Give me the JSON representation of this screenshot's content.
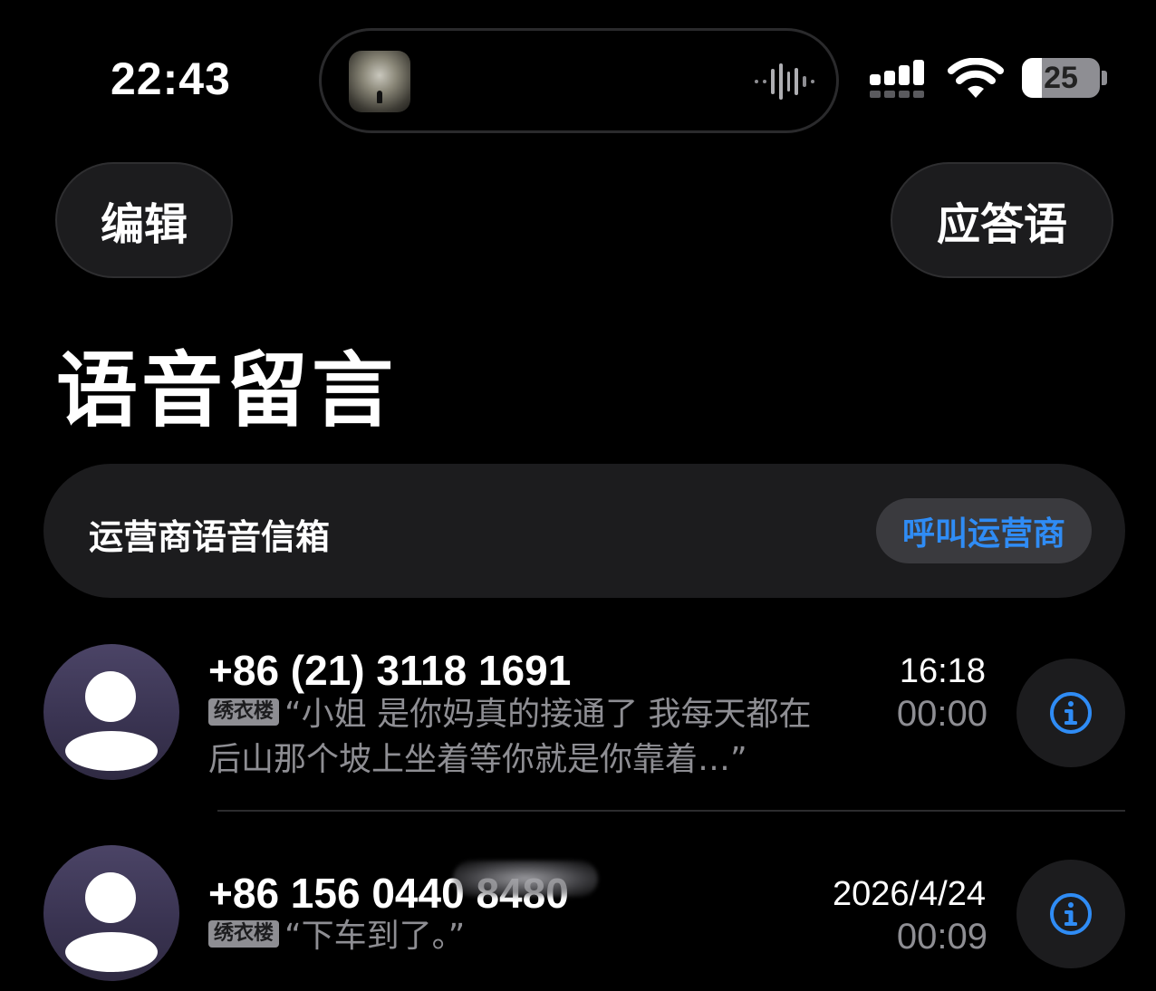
{
  "status_bar": {
    "time": "22:43",
    "battery_level": "25",
    "battery_fraction": 0.25,
    "icons": [
      "now-playing-artwork-icon",
      "audio-waveform-icon",
      "cellular-signal-icon",
      "wifi-icon",
      "battery-icon"
    ]
  },
  "nav": {
    "edit_label": "编辑",
    "greeting_label": "应答语"
  },
  "page": {
    "title": "语音留言"
  },
  "carrier": {
    "label": "运营商语音信箱",
    "call_button_label": "呼叫运营商",
    "accent_color": "#2f8cf5"
  },
  "voicemails": [
    {
      "number": "+86 (21) 3118 1691",
      "tag": "绣衣楼",
      "transcript": "“小姐 是你妈真的接通了 我每天都在后山那个坡上坐着等你就是你靠着…”",
      "date": "16:18",
      "duration": "00:00"
    },
    {
      "number": "+86 156 0440 8480",
      "tag": "绣衣楼",
      "transcript": "“下车到了。”",
      "date": "2026/4/24",
      "duration": "00:09"
    }
  ]
}
